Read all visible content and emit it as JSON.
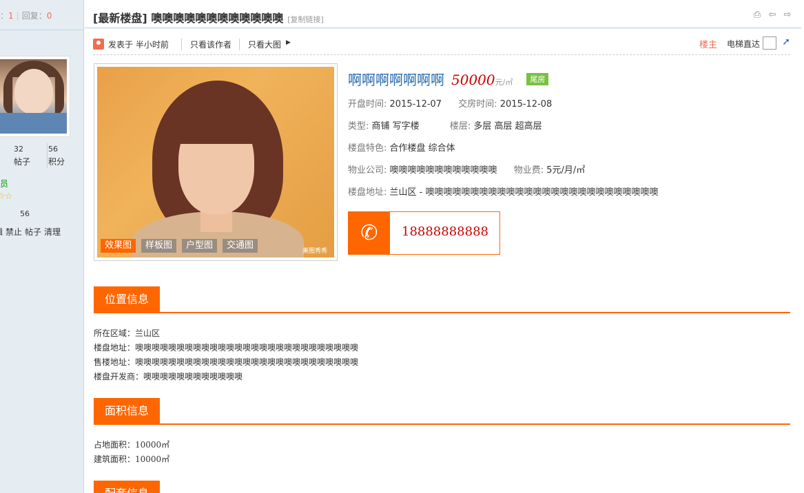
{
  "sidebar": {
    "views_label": "查看：",
    "views_value": "1",
    "replies_label": "回复：",
    "replies_value": "0",
    "posts_value": "32",
    "posts_label": "帖子",
    "points_value": "56",
    "points_label": "积分",
    "group": "员",
    "stars": "☆☆",
    "credit": "56",
    "admin_links": [
      "辑",
      "禁止",
      "帖子",
      "清理"
    ]
  },
  "thread": {
    "title": "[最新楼盘] 噢噢噢噢噢噢噢噢噢噢噢噢",
    "copy_link": "[复制链接]"
  },
  "meta": {
    "posted": "发表于  半小时前",
    "only_author": "只看该作者",
    "big_image": "只看大图",
    "op": "楼主",
    "elevator": "电梯直达"
  },
  "gallery": {
    "tabs": [
      "效果图",
      "样板图",
      "户型图",
      "交通图"
    ],
    "watermark": "美图秀秀"
  },
  "property": {
    "name": "啊啊啊啊啊啊啊",
    "price": "50000",
    "price_unit": "元/㎡",
    "badge": "尾房",
    "open_label": "开盘时间:",
    "open_value": "2015-12-07",
    "handover_label": "交房时间:",
    "handover_value": "2015-12-08",
    "type_label": "类型:",
    "type_value": "商铺  写字楼",
    "floor_label": "楼层:",
    "floor_value": "多层  高层  超高层",
    "feature_label": "楼盘特色:",
    "feature_value": "合作楼盘  综合体",
    "company_label": "物业公司:",
    "company_value": "噢噢噢噢噢噢噢噢噢噢噢噢",
    "fee_label": "物业费:",
    "fee_value": "5元/月/㎡",
    "address_label": "楼盘地址:",
    "address_value": "兰山区 - 噢噢噢噢噢噢噢噢噢噢噢噢噢噢噢噢噢噢噢噢噢噢噢噢噢噢",
    "phone": "18888888888"
  },
  "sections": {
    "location": {
      "title": "位置信息",
      "lines": [
        "所在区域：兰山区",
        "楼盘地址：噢噢噢噢噢噢噢噢噢噢噢噢噢噢噢噢噢噢噢噢噢噢噢噢噢噢噢",
        "售楼地址：噢噢噢噢噢噢噢噢噢噢噢噢噢噢噢噢噢噢噢噢噢噢噢噢噢噢噢",
        "楼盘开发商：噢噢噢噢噢噢噢噢噢噢噢噢"
      ]
    },
    "area": {
      "title": "面积信息",
      "lines": [
        "占地面积：10000㎡",
        "建筑面积：10000㎡"
      ]
    },
    "support": {
      "title": "配套信息"
    }
  }
}
